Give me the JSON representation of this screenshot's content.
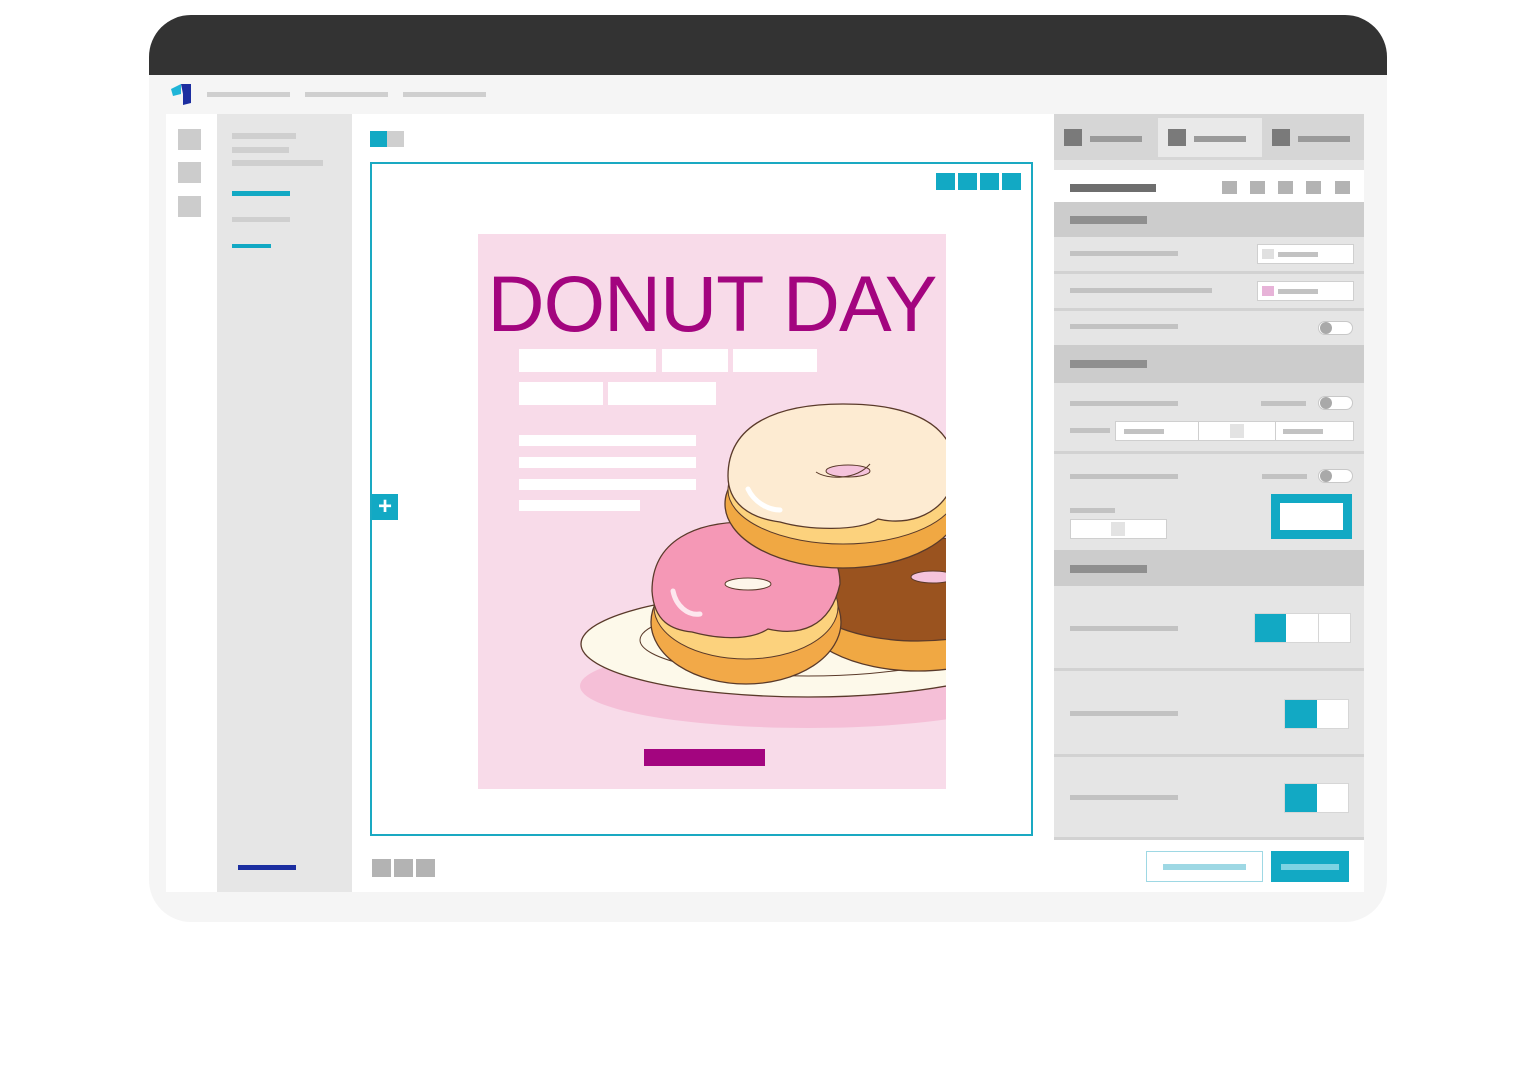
{
  "colors": {
    "device_bezel": "#f5f5f5",
    "device_top": "#333333",
    "accent": "#12a9c4",
    "title_magenta": "#a3057f",
    "poster_bg": "#f8dbe9",
    "nav_active_dark": "#1c2ea0"
  },
  "icons": {
    "logo": "app-logo-icon",
    "add": "plus-icon"
  },
  "canvas": {
    "add_symbol": "+",
    "poster": {
      "title": "DONUT DAY"
    }
  }
}
